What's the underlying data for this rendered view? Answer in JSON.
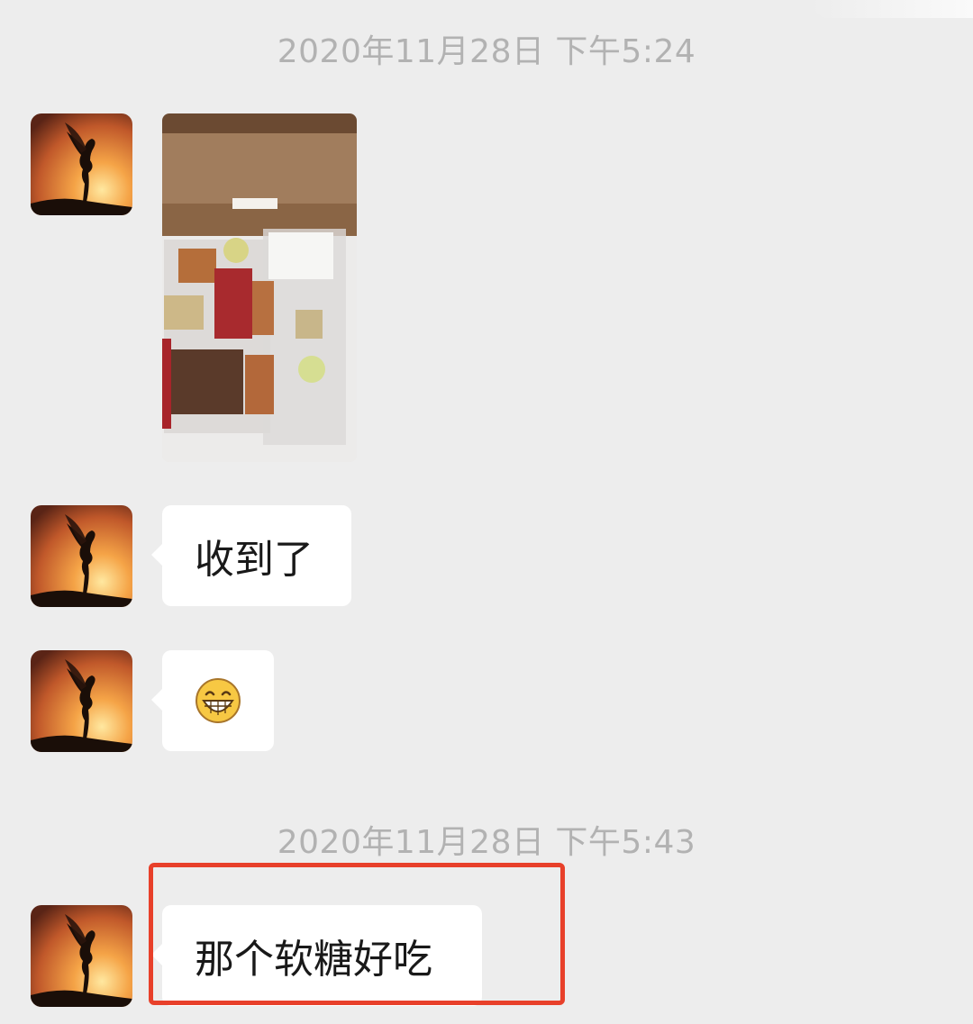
{
  "chat": {
    "timestamps": [
      "2020年11月28日 下午5:24",
      "2020年11月28日 下午5:43"
    ],
    "messages": [
      {
        "type": "image",
        "description_icon": "photo-gift-box"
      },
      {
        "type": "text",
        "text": "收到了"
      },
      {
        "type": "emoji",
        "icon": "grinning-face-emoji",
        "text": "😁"
      },
      {
        "type": "text",
        "text": "那个软糖好吃"
      }
    ]
  },
  "colors": {
    "background": "#ededed",
    "bubble": "#ffffff",
    "timestamp": "#b2b2b2",
    "highlight": "#e8402a"
  }
}
